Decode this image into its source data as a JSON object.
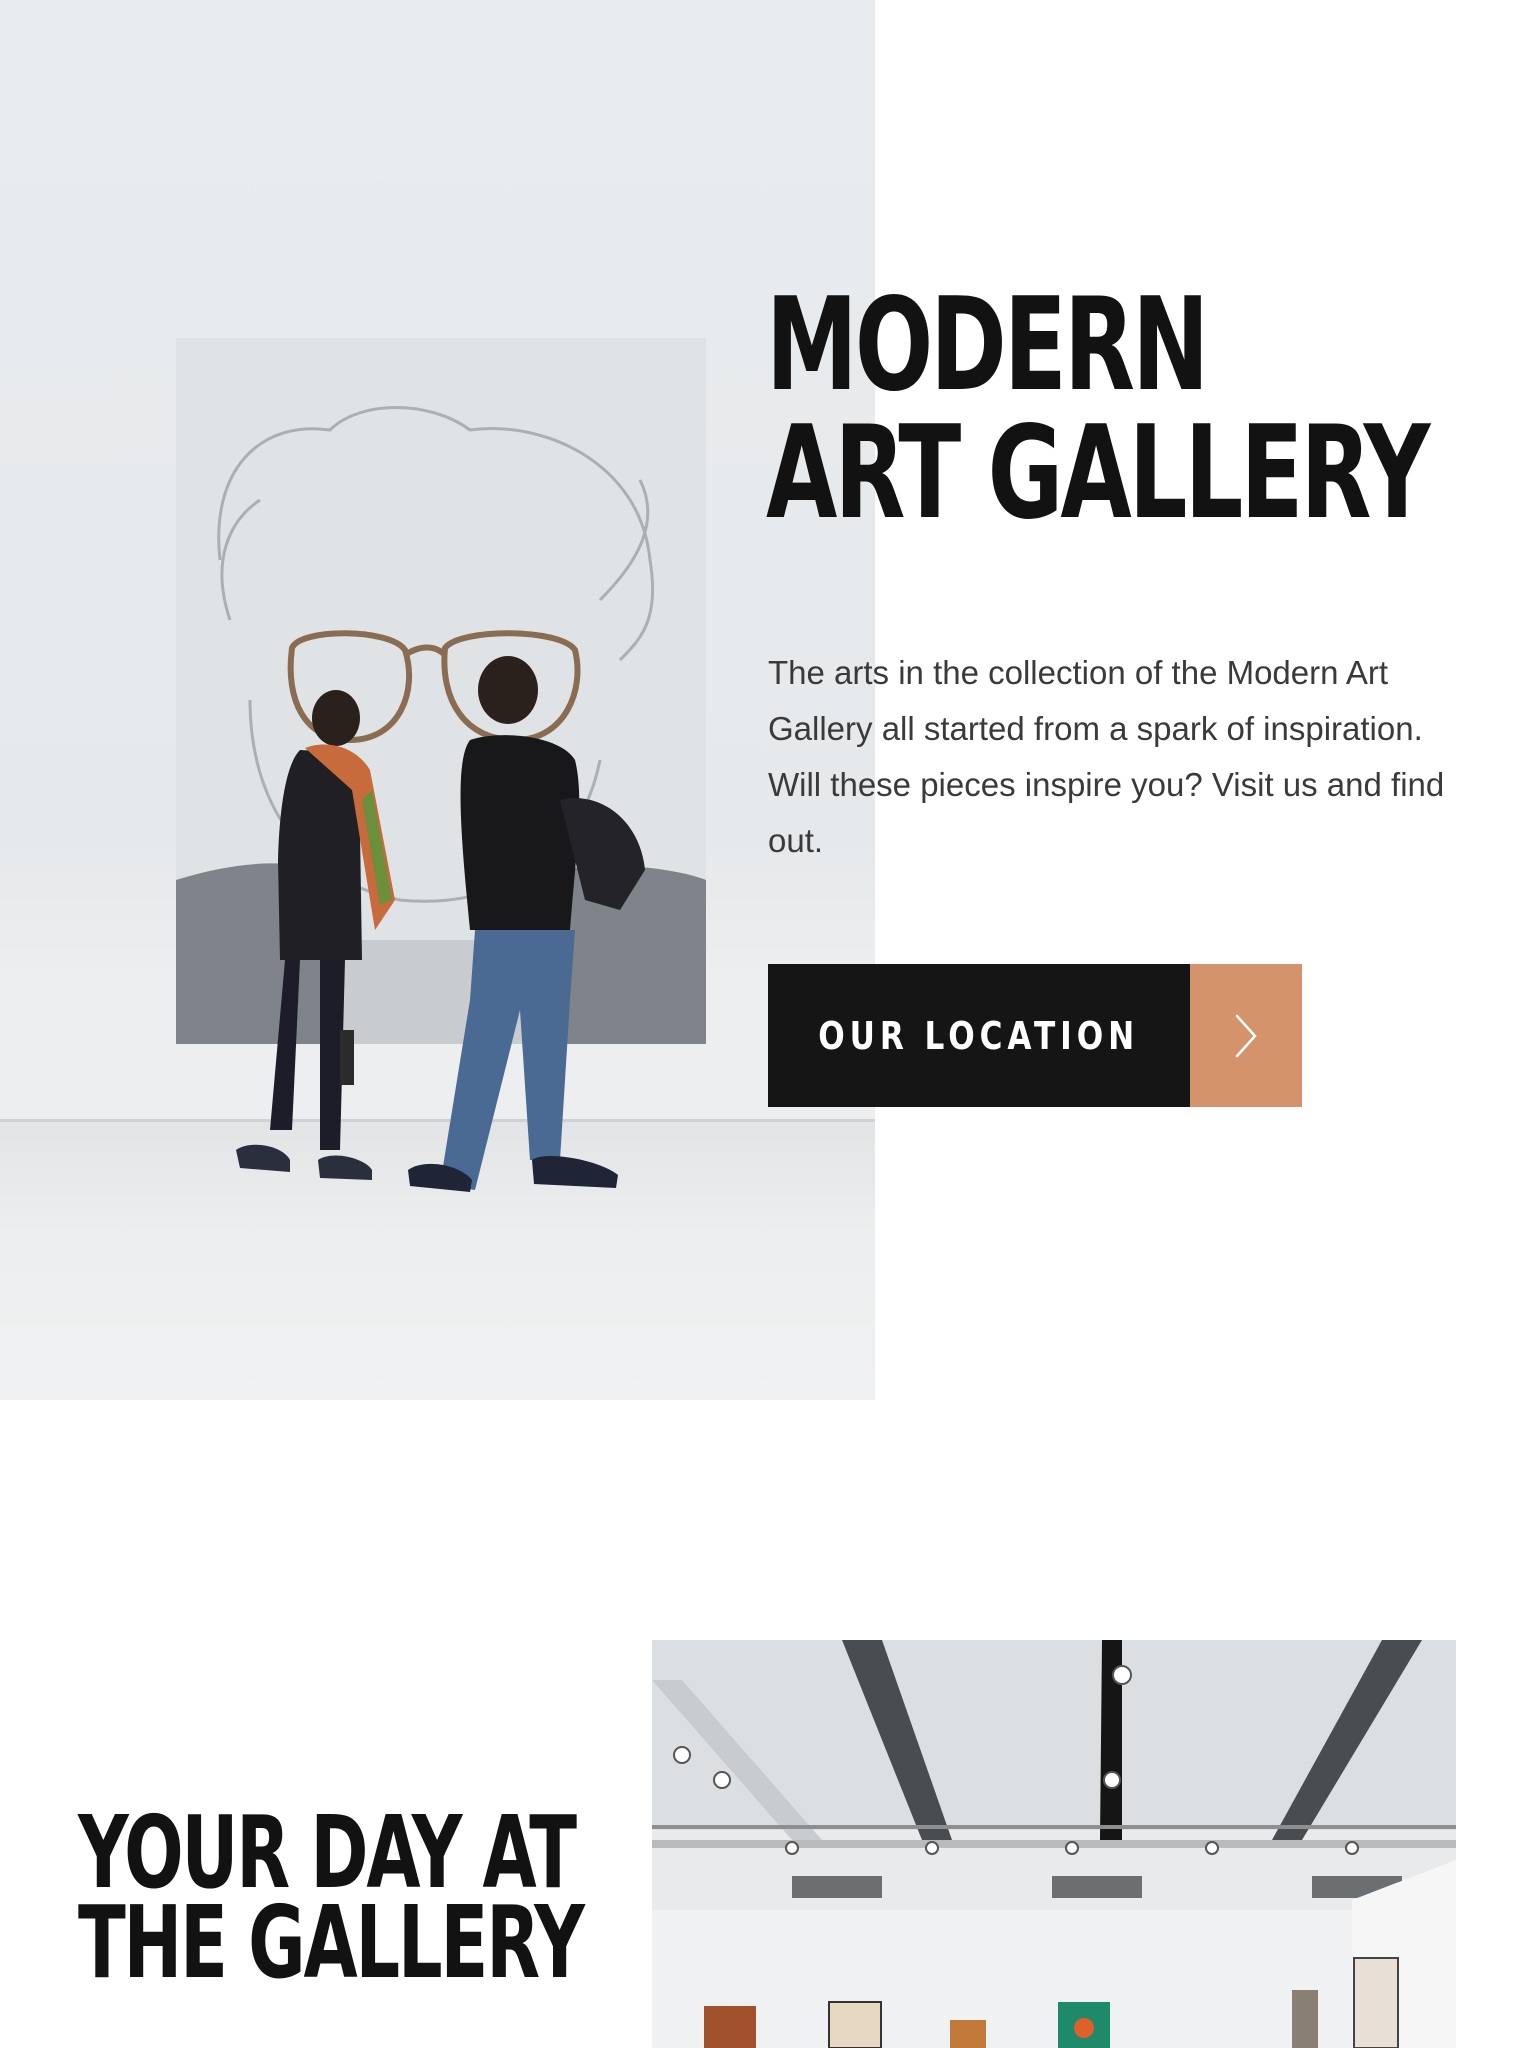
{
  "hero": {
    "title_line1": "MODERN",
    "title_line2": "ART GALLERY",
    "description": "The arts in the collection of the Modern Art Gallery all started from a spark of inspiration. Will these pieces inspire you? Visit us and find out.",
    "cta_label": "OUR LOCATION",
    "cta_arrow_icon": "chevron-right-icon"
  },
  "day_section": {
    "title_line1": "YOUR DAY AT",
    "title_line2": "THE GALLERY"
  },
  "colors": {
    "accent": "#d4936a",
    "button_dark": "#151515",
    "heading": "#121212",
    "body_text": "#3a3a3a"
  }
}
